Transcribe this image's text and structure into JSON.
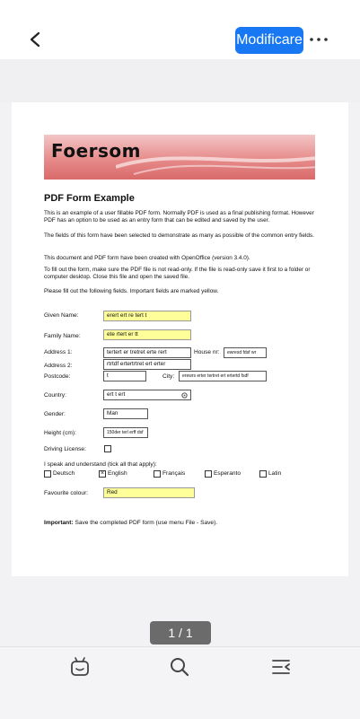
{
  "header": {
    "edit_label": "Modificare",
    "back_icon": "chevron-left-icon",
    "more_icon": "more-horizontal-icon",
    "accent_color": "#1877f2"
  },
  "document": {
    "logo_text": "Foersom",
    "title": "PDF Form Example",
    "paragraphs": [
      "This is an example of a user fillable PDF form. Normally PDF is used as a final publishing format. However PDF has an option to be used as an entry form that can be edited and saved by the user.",
      "The fields of this form have been selected to demonstrate as many as possible of the common entry fields.",
      "This document and PDF form have been created with OpenOffice (version 3.4.0).",
      "To fill out the form, make sure the PDF file is not read-only. If the file is read-only save it first to a folder or computer desktop. Close this file and open the saved file.",
      "Please fill out the following fields. Important fields are marked yellow."
    ],
    "form": {
      "given_name_label": "Given Name:",
      "given_name_value": "erert ert re tert t",
      "family_name_label": "Family Name:",
      "family_name_value": "ete rtert er tt",
      "address1_label": "Address 1:",
      "address1_value": "tertert er tretret  erte rert",
      "house_nr_label": "House nr:",
      "house_nr_value": "ewresd fdsf wr",
      "address2_label": "Address 2:",
      "address2_value": "rtrtdf ertertrtret ert erter",
      "postcode_label": "Postcode:",
      "postcode_value": "t",
      "city_label": "City:",
      "city_value": "erewrs erter tertret ert ertertd fsdf",
      "country_label": "Country:",
      "country_value": "ert t ert",
      "gender_label": "Gender:",
      "gender_value": "Man",
      "height_label": "Height (cm):",
      "height_value": "150der terl erff dsf",
      "driving_label": "Driving License:",
      "languages_label": "I speak and understand (tick all that apply):",
      "languages": [
        {
          "label": "Deutsch",
          "checked": false
        },
        {
          "label": "English",
          "checked": true
        },
        {
          "label": "Français",
          "checked": false
        },
        {
          "label": "Esperanto",
          "checked": false
        },
        {
          "label": "Latin",
          "checked": false
        }
      ],
      "colour_label": "Favourite colour:",
      "colour_value": "Red",
      "important_bold": "Important:",
      "important_text": " Save the completed PDF form (use menu File - Save).",
      "highlight_color": "#ffff99"
    }
  },
  "pager": {
    "text": "1 / 1"
  },
  "toolbar": {
    "icons": [
      "robot-assistant-icon",
      "search-icon",
      "list-menu-icon"
    ]
  }
}
